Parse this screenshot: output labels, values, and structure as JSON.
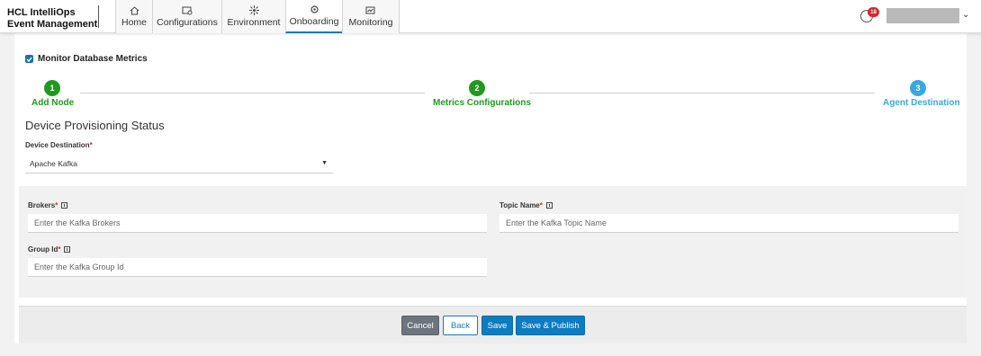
{
  "header": {
    "brand_line1": "HCL IntelliOps",
    "brand_line2": "Event Management",
    "tabs": [
      {
        "label": "Home",
        "icon": "home-icon"
      },
      {
        "label": "Configurations",
        "icon": "configurations-icon"
      },
      {
        "label": "Environment",
        "icon": "environment-icon"
      },
      {
        "label": "Onboarding",
        "icon": "onboarding-icon",
        "active": true
      },
      {
        "label": "Monitoring",
        "icon": "monitoring-icon"
      }
    ],
    "alert_count": "18"
  },
  "monitor_checkbox": {
    "label": "Monitor Database Metrics",
    "checked": true
  },
  "stepper": {
    "steps": [
      {
        "number": "1",
        "label": "Add Node",
        "color": "#1f9a1f"
      },
      {
        "number": "2",
        "label": "Metrics Configurations",
        "color": "#1f9a1f"
      },
      {
        "number": "3",
        "label": "Agent Destination",
        "color": "#3aa8de"
      }
    ]
  },
  "section_title": "Device Provisioning Status",
  "device_destination": {
    "label": "Device Destination",
    "required": "*",
    "value": "Apache Kafka"
  },
  "fields": {
    "brokers": {
      "label": "Brokers",
      "required": "*",
      "placeholder": "Enter the Kafka Brokers"
    },
    "topic": {
      "label": "Topic Name",
      "required": "*",
      "placeholder": "Enter the Kafka Topic Name"
    },
    "group": {
      "label": "Group Id",
      "required": "*",
      "placeholder": "Enter the Kafka Group Id"
    }
  },
  "buttons": {
    "cancel": "Cancel",
    "back": "Back",
    "save": "Save",
    "save_publish": "Save & Publish"
  },
  "colors": {
    "primary": "#0d7cc1",
    "success": "#1f9a1f",
    "pending": "#3aa8de",
    "danger": "#d9262f"
  }
}
